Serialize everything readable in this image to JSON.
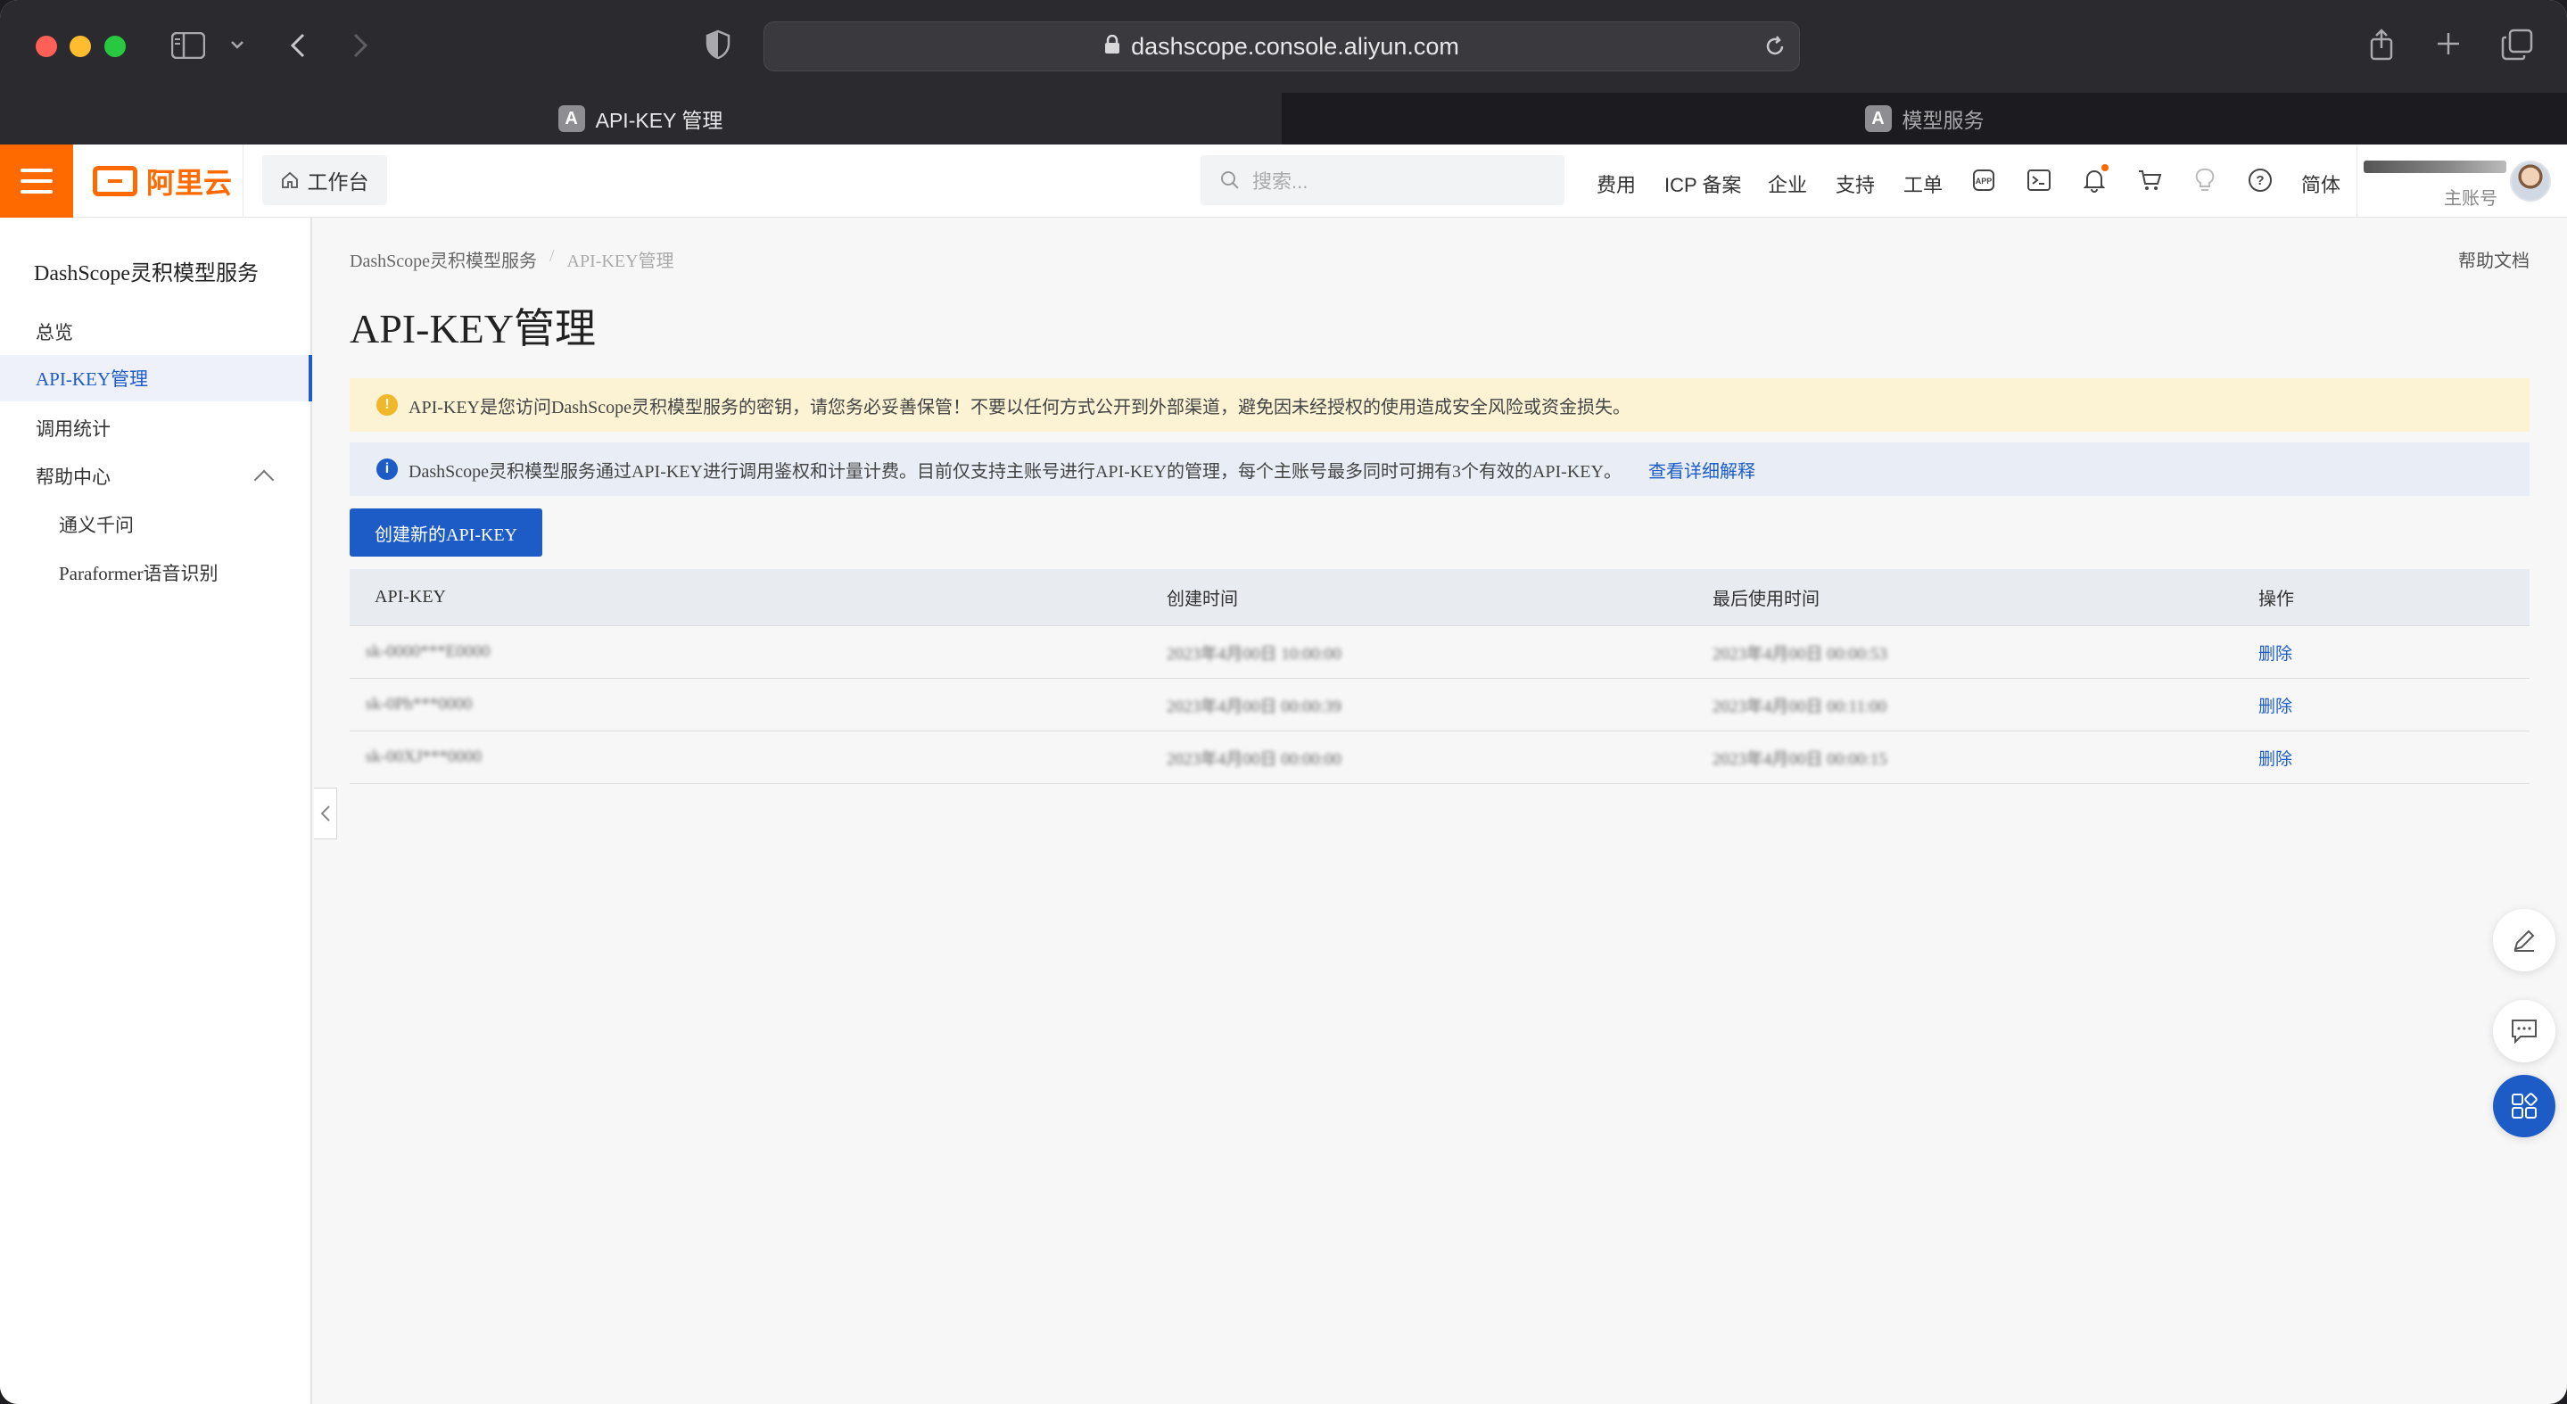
{
  "browser": {
    "url": "dashscope.console.aliyun.com",
    "tabs": [
      {
        "label": "API-KEY 管理",
        "favicon": "A"
      },
      {
        "label": "模型服务",
        "favicon": "A"
      }
    ]
  },
  "topnav": {
    "logo_text": "阿里云",
    "workbench": "工作台",
    "search_placeholder": "搜索...",
    "links": [
      "费用",
      "ICP 备案",
      "企业",
      "支持",
      "工单"
    ],
    "lang": "简体",
    "account_role": "主账号"
  },
  "sidebar": {
    "title": "DashScope灵积模型服务",
    "items": [
      {
        "label": "总览"
      },
      {
        "label": "API-KEY管理"
      },
      {
        "label": "调用统计"
      },
      {
        "label": "帮助中心"
      },
      {
        "label": "通义千问"
      },
      {
        "label": "Paraformer语音识别"
      }
    ]
  },
  "main": {
    "breadcrumb": [
      "DashScope灵积模型服务",
      "API-KEY管理"
    ],
    "help_doc": "帮助文档",
    "title": "API-KEY管理",
    "warning": "API-KEY是您访问DashScope灵积模型服务的密钥，请您务必妥善保管！不要以任何方式公开到外部渠道，避免因未经授权的使用造成安全风险或资金损失。",
    "info": "DashScope灵积模型服务通过API-KEY进行调用鉴权和计量计费。目前仅支持主账号进行API-KEY的管理，每个主账号最多同时可拥有3个有效的API-KEY。",
    "info_link": "查看详细解释",
    "create_button": "创建新的API-KEY",
    "table": {
      "headers": [
        "API-KEY",
        "创建时间",
        "最后使用时间",
        "操作"
      ],
      "rows": [
        {
          "key": "sk-0000***E0000",
          "created": "2023年4月00日 10:00:00",
          "last_used": "2023年4月00日 00:00:53",
          "action": "删除"
        },
        {
          "key": "sk-0Ph***0000",
          "created": "2023年4月00日 00:00:39",
          "last_used": "2023年4月00日 00:11:00",
          "action": "删除"
        },
        {
          "key": "sk-00XJ***0000",
          "created": "2023年4月00日 00:00:00",
          "last_used": "2023年4月00日 00:00:15",
          "action": "删除"
        }
      ]
    }
  },
  "colors": {
    "brand_orange": "#ff6a00",
    "primary_blue": "#1d5cc7"
  }
}
